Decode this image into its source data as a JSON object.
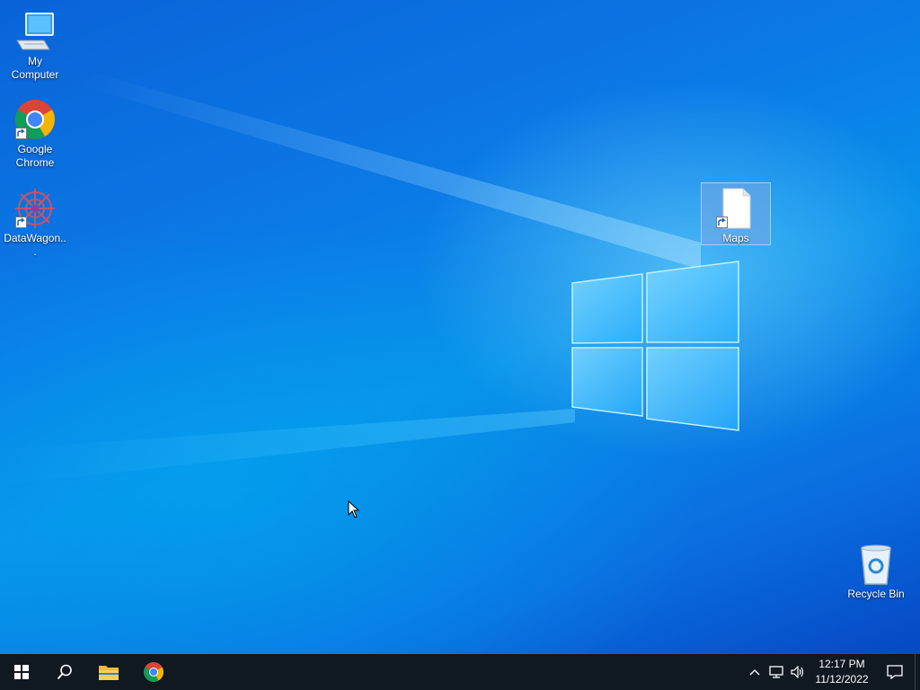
{
  "desktop": {
    "icons_left": [
      {
        "name": "my-computer",
        "label": "My Computer",
        "icon": "computer-icon"
      },
      {
        "name": "google-chrome",
        "label": "Google Chrome",
        "icon": "chrome-icon",
        "shortcut": true
      },
      {
        "name": "datawagon",
        "label": "DataWagon...",
        "icon": "datawagon-icon",
        "shortcut": true
      }
    ],
    "maps": {
      "label": "Maps",
      "icon": "document-icon",
      "shortcut": true,
      "selected": true
    },
    "recycle_bin": {
      "label": "Recycle Bin",
      "icon": "recycle-bin-icon"
    }
  },
  "taskbar": {
    "start_icon": "windows-logo-icon",
    "search_icon": "search-icon",
    "pinned": [
      {
        "name": "file-explorer",
        "icon": "folder-icon"
      },
      {
        "name": "chrome",
        "icon": "chrome-icon"
      }
    ],
    "tray": {
      "icons": [
        "chevron-up-icon",
        "network-icon",
        "volume-icon"
      ],
      "time": "12:17 PM",
      "date": "11/12/2022",
      "notification_icon": "notification-icon"
    }
  },
  "colors": {
    "taskbar_bg": "#101820",
    "selection_bg": "#6fa6e3",
    "wallpaper_blue": "#0a7ae6"
  }
}
